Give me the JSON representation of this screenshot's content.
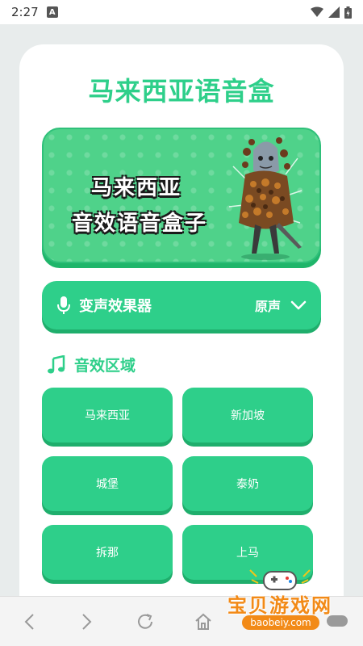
{
  "status_bar": {
    "time": "2:27",
    "notification": "A"
  },
  "app": {
    "title": "马来西亚语音盒"
  },
  "banner": {
    "line1": "马来西亚",
    "line2": "音效语音盒子"
  },
  "voice_changer": {
    "label": "变声效果器",
    "selected": "原声"
  },
  "section": {
    "title": "音效区域"
  },
  "sounds": [
    "马来西亚",
    "新加坡",
    "城堡",
    "泰奶",
    "拆那",
    "上马"
  ],
  "watermark": {
    "text": "宝贝游戏网",
    "url": "baobeiy.com"
  },
  "colors": {
    "accent": "#2ecf8a",
    "accent_dark": "#1fae6c",
    "watermark": "#f28a17"
  },
  "icons": {
    "voice": "microphone-icon",
    "section": "music-note-icon",
    "dropdown": "chevron-down-icon"
  }
}
